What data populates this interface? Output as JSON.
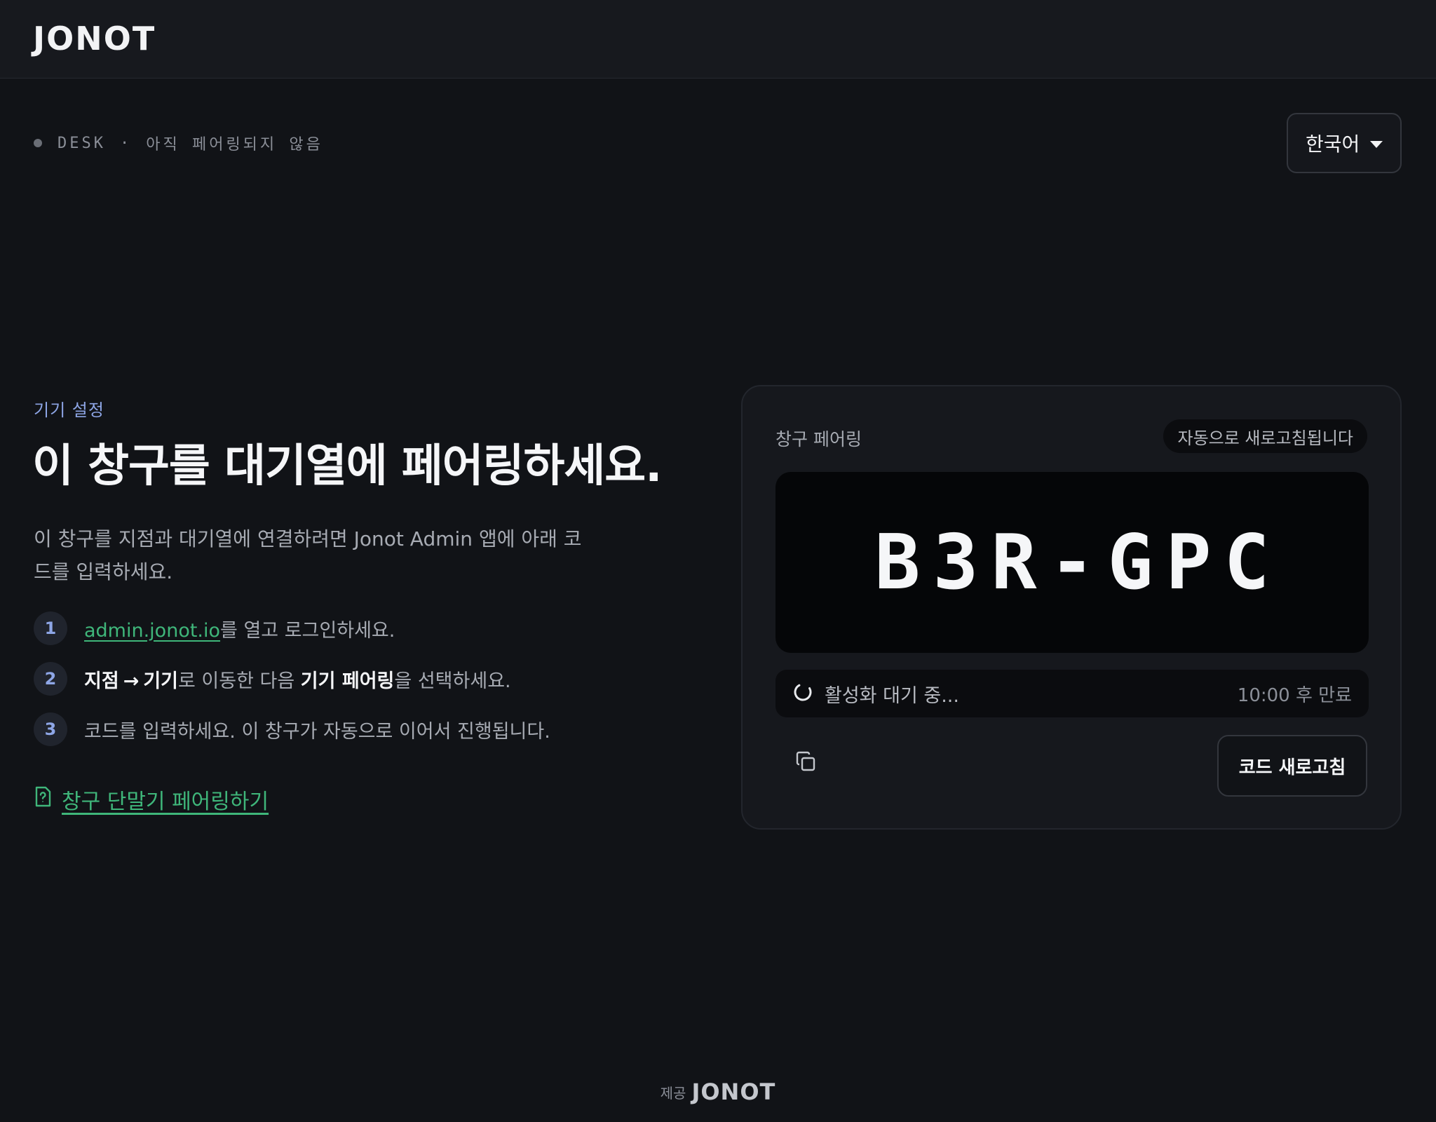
{
  "header": {
    "logo_text": "JONOT"
  },
  "status": {
    "device_label": "DESK",
    "separator": "·",
    "pairing_state": "아직 페어링되지 않음"
  },
  "language": {
    "selected": "한국어",
    "icon": "caret-down-icon"
  },
  "intro": {
    "eyebrow": "기기 설정",
    "headline": "이 창구를 대기열에 페어링하세요.",
    "description": "이 창구를 지점과 대기열에 연결하려면 Jonot Admin 앱에 아래 코드를 입력하세요."
  },
  "steps": [
    {
      "number": "1",
      "link": "admin.jonot.io",
      "text": "를 열고 로그인하세요."
    },
    {
      "number": "2",
      "bold1": "지점",
      "arrow": "→",
      "bold2": "기기",
      "mid": "로 이동한 다음 ",
      "bold3": "기기 페어링",
      "end": "을 선택하세요."
    },
    {
      "number": "3",
      "text": "코드를 입력하세요. 이 창구가 자동으로 이어서 진행됩니다."
    }
  ],
  "help": {
    "label": "창구 단말기 페어링하기",
    "icon": "help-document-icon"
  },
  "card": {
    "title": "창구 페어링",
    "auto_refresh_badge": "자동으로 새로고침됩니다",
    "code": "B3R-GPC",
    "waiting_text": "활성화 대기 중...",
    "expires_text": "10:00 후 만료",
    "copy_icon": "copy-icon",
    "refresh_button": "코드 새로고침"
  },
  "footer": {
    "prefix": "제공",
    "logo_text": "JONOT"
  },
  "colors": {
    "background": "#111317",
    "accent_green": "#3fb67a",
    "accent_blue": "#8ea6e6",
    "card_background": "#16181d"
  }
}
